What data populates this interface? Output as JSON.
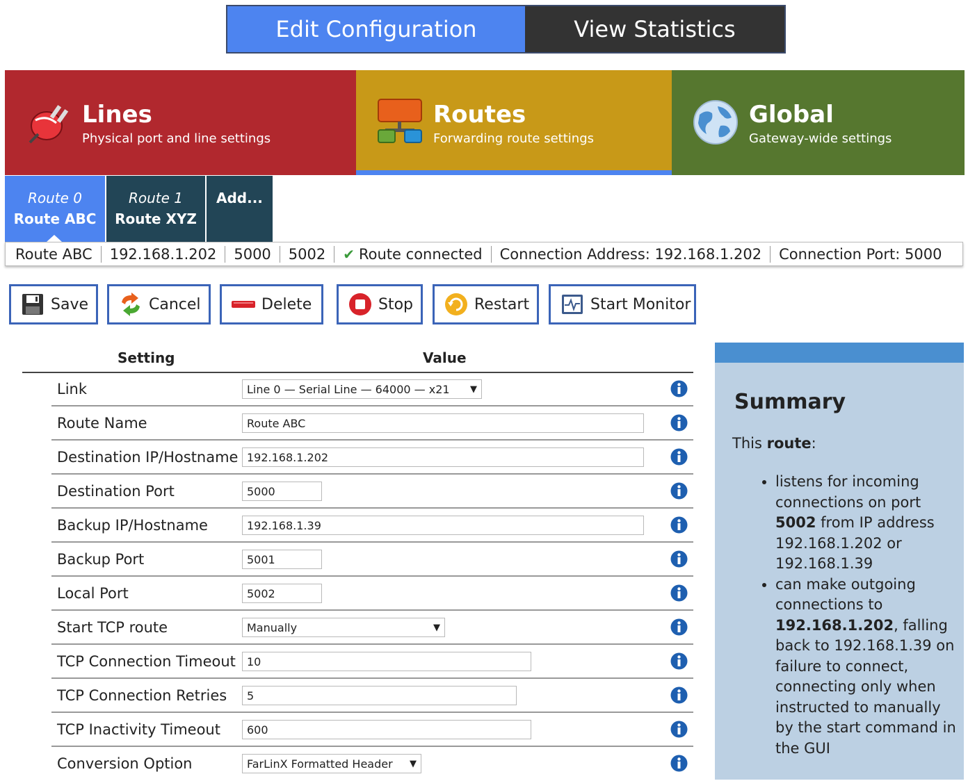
{
  "top_toggle": {
    "edit": "Edit Configuration",
    "stats": "View Statistics"
  },
  "categories": [
    {
      "title": "Lines",
      "subtitle": "Physical port and line settings",
      "color": "#b1282e",
      "icon": "plug-icon"
    },
    {
      "title": "Routes",
      "subtitle": "Forwarding route settings",
      "color": "#c89918",
      "icon": "routes-icon",
      "active": true
    },
    {
      "title": "Global",
      "subtitle": "Gateway-wide settings",
      "color": "#56772f",
      "icon": "globe-icon"
    }
  ],
  "route_tabs": [
    {
      "num": "Route 0",
      "name": "Route ABC",
      "active": true
    },
    {
      "num": "Route 1",
      "name": "Route XYZ"
    },
    {
      "name": "Add..."
    }
  ],
  "status": {
    "name": "Route ABC",
    "ip": "192.168.1.202",
    "port1": "5000",
    "port2": "5002",
    "state": "Route connected",
    "conn_address": "Connection Address: 192.168.1.202",
    "conn_port": "Connection Port: 5000"
  },
  "actions": {
    "save": "Save",
    "cancel": "Cancel",
    "delete": "Delete",
    "stop": "Stop",
    "restart": "Restart",
    "start_monitor": "Start Monitor"
  },
  "table": {
    "col_setting": "Setting",
    "col_value": "Value",
    "rows": [
      {
        "label": "Link",
        "value": "Line 0 — Serial Line — 64000 — x21",
        "type": "select"
      },
      {
        "label": "Route Name",
        "value": "Route ABC",
        "type": "text"
      },
      {
        "label": "Destination IP/Hostname",
        "value": "192.168.1.202",
        "type": "text"
      },
      {
        "label": "Destination Port",
        "value": "5000",
        "type": "text"
      },
      {
        "label": "Backup IP/Hostname",
        "value": "192.168.1.39",
        "type": "text"
      },
      {
        "label": "Backup Port",
        "value": "5001",
        "type": "text"
      },
      {
        "label": "Local Port",
        "value": "5002",
        "type": "text"
      },
      {
        "label": "Start TCP route",
        "value": "Manually",
        "type": "select"
      },
      {
        "label": "TCP Connection Timeout",
        "value": "10",
        "type": "text"
      },
      {
        "label": "TCP Connection Retries",
        "value": "5",
        "type": "text"
      },
      {
        "label": "TCP Inactivity Timeout",
        "value": "600",
        "type": "text"
      },
      {
        "label": "Conversion Option",
        "value": "FarLinX Formatted Header",
        "type": "select"
      }
    ]
  },
  "summary": {
    "title": "Summary",
    "intro_prefix": "This ",
    "intro_bold": "route",
    "intro_suffix": ":",
    "b1_a": "listens for incoming connections on port ",
    "b1_port": "5002",
    "b1_b": " from IP address 192.168.1.202 or 192.168.1.39",
    "b2_a": "can make outgoing connections to ",
    "b2_ip": "192.168.1.202",
    "b2_b": ", falling back to 192.168.1.39 on failure to connect, connecting only when instructed to manually by the start command in the GUI"
  }
}
